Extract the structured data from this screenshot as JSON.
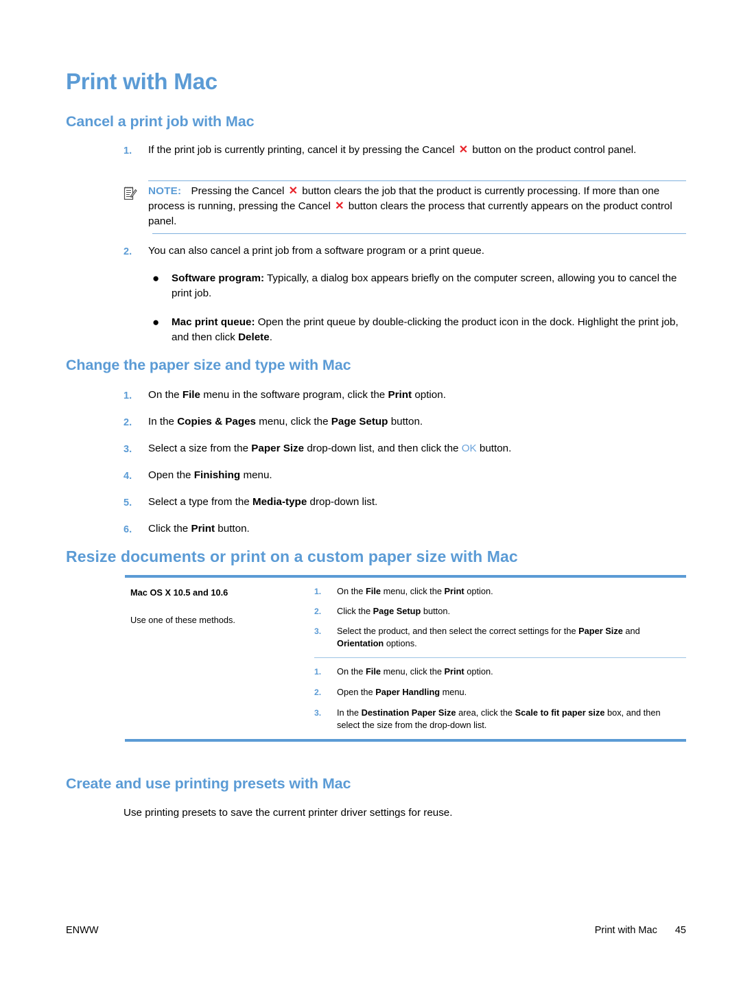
{
  "page": {
    "title": "Print with Mac",
    "footer": {
      "left": "ENWW",
      "right_label": "Print with Mac",
      "page_number": "45"
    },
    "accent_color": "#5B9BD5",
    "cancel_icon_color": "#E8232A"
  },
  "section_cancel": {
    "heading": "Cancel a print job with Mac",
    "steps": [
      {
        "num": "1.",
        "parts": [
          {
            "t": "If the print job is currently printing, cancel it by pressing the Cancel ",
            "s": "plain"
          },
          {
            "t": "✕",
            "s": "cancel-icon"
          },
          {
            "t": " button on the product control panel.",
            "s": "plain"
          }
        ]
      },
      {
        "num": "2.",
        "parts": [
          {
            "t": "You can also cancel a print job from a software program or a print queue.",
            "s": "plain"
          }
        ]
      }
    ],
    "note": {
      "icon": "note-pad-icon",
      "label": "NOTE:",
      "parts": [
        {
          "t": "Pressing the Cancel ",
          "s": "plain"
        },
        {
          "t": "✕",
          "s": "cancel-icon"
        },
        {
          "t": " button clears the job that the product is currently processing. If more than one process is running, pressing the Cancel ",
          "s": "plain"
        },
        {
          "t": "✕",
          "s": "cancel-icon"
        },
        {
          "t": " button clears the process that currently appears on the product control panel.",
          "s": "plain"
        }
      ]
    },
    "bullets": [
      {
        "dot": "●",
        "parts": [
          {
            "t": "Software program:",
            "s": "bold"
          },
          {
            "t": " Typically, a dialog box appears briefly on the computer screen, allowing you to cancel the print job.",
            "s": "plain"
          }
        ]
      },
      {
        "dot": "●",
        "parts": [
          {
            "t": "Mac print queue:",
            "s": "bold"
          },
          {
            "t": " Open the print queue by double-clicking the product icon in the dock. Highlight the print job, and then click ",
            "s": "plain"
          },
          {
            "t": "Delete",
            "s": "bold"
          },
          {
            "t": ".",
            "s": "plain"
          }
        ]
      }
    ]
  },
  "section_paper": {
    "heading": "Change the paper size and type with Mac",
    "steps": [
      {
        "num": "1.",
        "parts": [
          {
            "t": "On the ",
            "s": "plain"
          },
          {
            "t": "File",
            "s": "bold"
          },
          {
            "t": " menu in the software program, click the ",
            "s": "plain"
          },
          {
            "t": "Print",
            "s": "bold"
          },
          {
            "t": " option.",
            "s": "plain"
          }
        ]
      },
      {
        "num": "2.",
        "parts": [
          {
            "t": "In the ",
            "s": "plain"
          },
          {
            "t": "Copies & Pages",
            "s": "bold"
          },
          {
            "t": " menu, click the ",
            "s": "plain"
          },
          {
            "t": "Page Setup",
            "s": "bold"
          },
          {
            "t": " button.",
            "s": "plain"
          }
        ]
      },
      {
        "num": "3.",
        "parts": [
          {
            "t": "Select a size from the ",
            "s": "plain"
          },
          {
            "t": "Paper Size",
            "s": "bold"
          },
          {
            "t": " drop-down list, and then click the ",
            "s": "plain"
          },
          {
            "t": "OK",
            "s": "link"
          },
          {
            "t": " button.",
            "s": "plain"
          }
        ]
      },
      {
        "num": "4.",
        "parts": [
          {
            "t": "Open the ",
            "s": "plain"
          },
          {
            "t": "Finishing",
            "s": "bold"
          },
          {
            "t": " menu.",
            "s": "plain"
          }
        ]
      },
      {
        "num": "5.",
        "parts": [
          {
            "t": "Select a type from the ",
            "s": "plain"
          },
          {
            "t": "Media-type",
            "s": "bold"
          },
          {
            "t": " drop-down list.",
            "s": "plain"
          }
        ]
      },
      {
        "num": "6.",
        "parts": [
          {
            "t": "Click the ",
            "s": "plain"
          },
          {
            "t": "Print",
            "s": "bold"
          },
          {
            "t": " button.",
            "s": "plain"
          }
        ]
      }
    ]
  },
  "section_resize": {
    "heading": "Resize documents or print on a custom paper size with Mac",
    "table": {
      "left_column": {
        "lead": "Mac OS X 10.5 and 10.6",
        "note": "Use one of these methods."
      },
      "procedures": [
        {
          "steps": [
            {
              "num": "1.",
              "parts": [
                {
                  "t": "On the ",
                  "s": "plain"
                },
                {
                  "t": "File",
                  "s": "bold"
                },
                {
                  "t": " menu, click the ",
                  "s": "plain"
                },
                {
                  "t": "Print",
                  "s": "bold"
                },
                {
                  "t": " option.",
                  "s": "plain"
                }
              ]
            },
            {
              "num": "2.",
              "parts": [
                {
                  "t": "Click the ",
                  "s": "plain"
                },
                {
                  "t": "Page Setup",
                  "s": "bold"
                },
                {
                  "t": " button.",
                  "s": "plain"
                }
              ]
            },
            {
              "num": "3.",
              "parts": [
                {
                  "t": "Select the product, and then select the correct settings for the ",
                  "s": "plain"
                },
                {
                  "t": "Paper Size",
                  "s": "bold"
                },
                {
                  "t": " and ",
                  "s": "plain"
                },
                {
                  "t": "Orientation",
                  "s": "bold"
                },
                {
                  "t": " options.",
                  "s": "plain"
                }
              ]
            }
          ]
        },
        {
          "steps": [
            {
              "num": "1.",
              "parts": [
                {
                  "t": "On the ",
                  "s": "plain"
                },
                {
                  "t": "File",
                  "s": "bold"
                },
                {
                  "t": " menu, click the ",
                  "s": "plain"
                },
                {
                  "t": "Print",
                  "s": "bold"
                },
                {
                  "t": " option.",
                  "s": "plain"
                }
              ]
            },
            {
              "num": "2.",
              "parts": [
                {
                  "t": "Open the ",
                  "s": "plain"
                },
                {
                  "t": "Paper Handling",
                  "s": "bold"
                },
                {
                  "t": " menu.",
                  "s": "plain"
                }
              ]
            },
            {
              "num": "3.",
              "parts": [
                {
                  "t": "In the ",
                  "s": "plain"
                },
                {
                  "t": "Destination Paper Size",
                  "s": "bold"
                },
                {
                  "t": " area, click the ",
                  "s": "plain"
                },
                {
                  "t": "Scale to fit paper size",
                  "s": "bold"
                },
                {
                  "t": " box, and then select the size from the drop-down list.",
                  "s": "plain"
                }
              ]
            }
          ]
        }
      ]
    }
  },
  "section_presets": {
    "heading": "Create and use printing presets with Mac",
    "paragraph": "Use printing presets to save the current printer driver settings for reuse."
  }
}
